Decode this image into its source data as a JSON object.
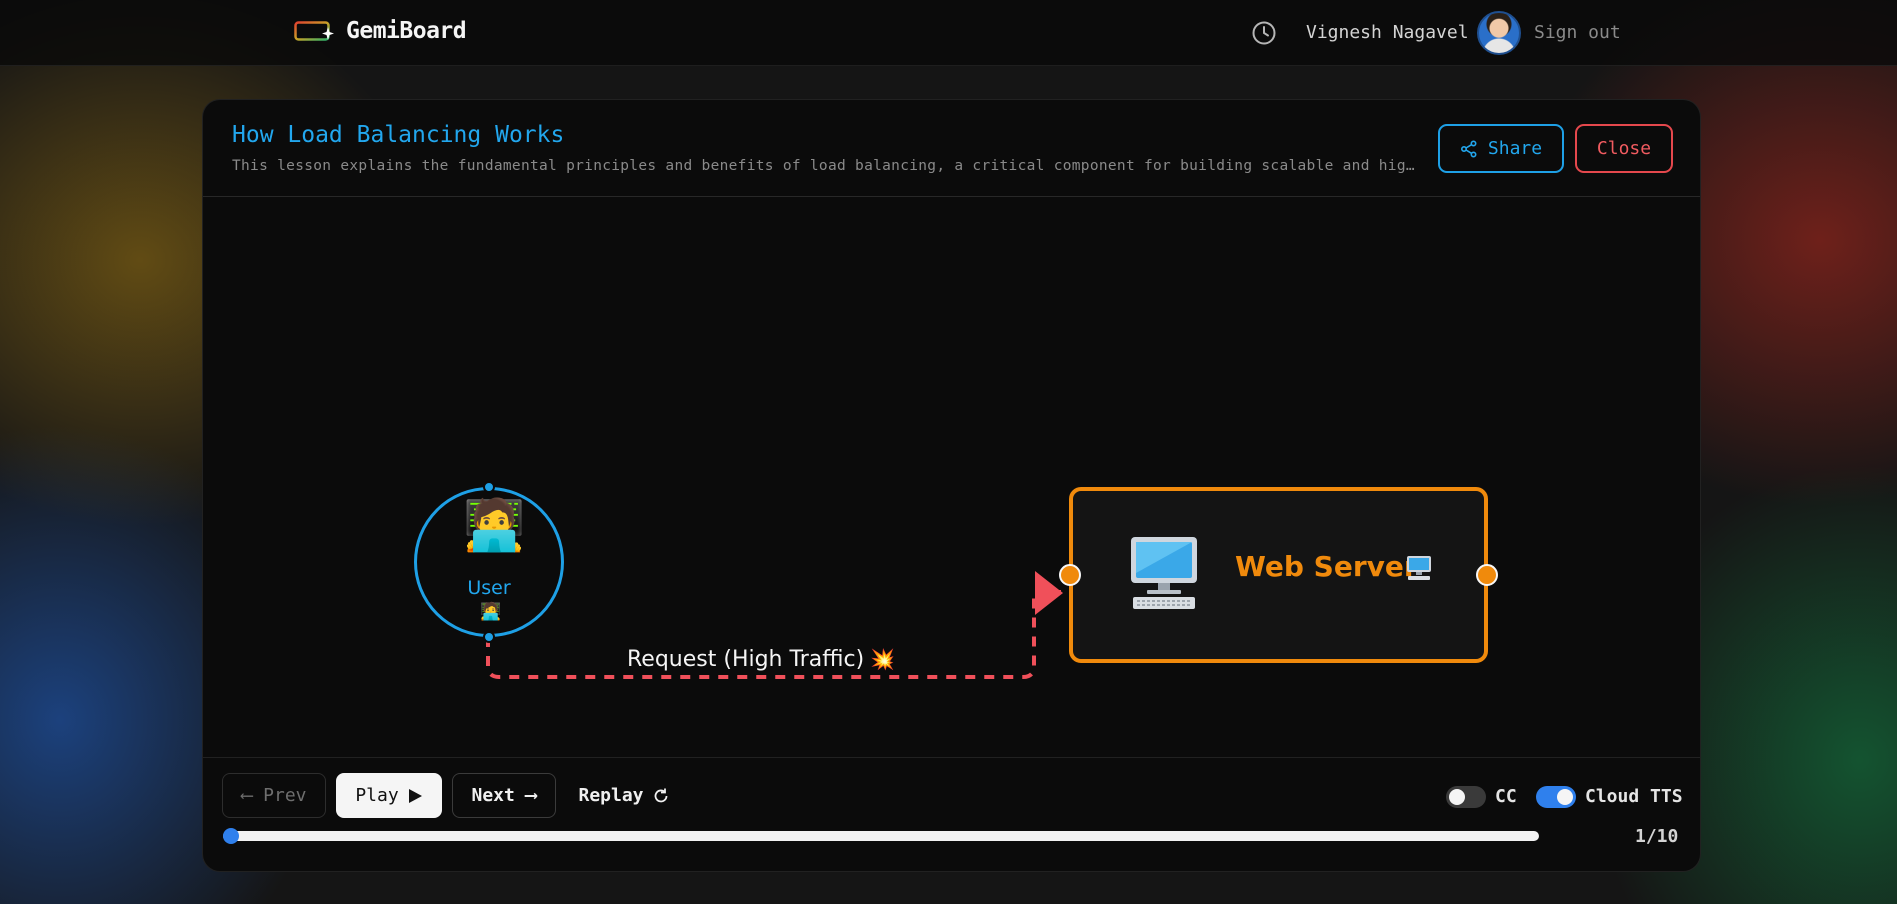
{
  "header": {
    "brand": "GemiBoard",
    "user_name": "Vignesh Nagavel",
    "sign_out": "Sign out",
    "icons": [
      "gemini-logo-icon",
      "history-clock-icon",
      "avatar"
    ]
  },
  "lesson": {
    "title": "How Load Balancing Works",
    "description": "This lesson explains the fundamental principles and benefits of load balancing, a critical component for building scalable and high…",
    "share_label": "Share",
    "close_label": "Close"
  },
  "diagram": {
    "user_node": {
      "label": "User",
      "icon": "🧑‍💻",
      "mini_icon": "🧑‍💻"
    },
    "server_node": {
      "label": "Web Server",
      "icon": "desktop-computer-icon"
    },
    "edge": {
      "label": "Request (High Traffic)",
      "icon": "💥",
      "style": "dashed",
      "color": "#f0505a"
    }
  },
  "controls": {
    "prev_label": "⟵ Prev",
    "play_label": "Play",
    "next_label": "Next ⟶",
    "replay_label": "Replay",
    "cc_label": "CC",
    "cc_enabled": false,
    "tts_label": "Cloud TTS",
    "tts_enabled": true,
    "progress": 0,
    "step_text": "1/10"
  },
  "colors": {
    "accent_blue": "#22a7ee",
    "accent_orange": "#f08a0c",
    "danger_red": "#e5484d"
  }
}
